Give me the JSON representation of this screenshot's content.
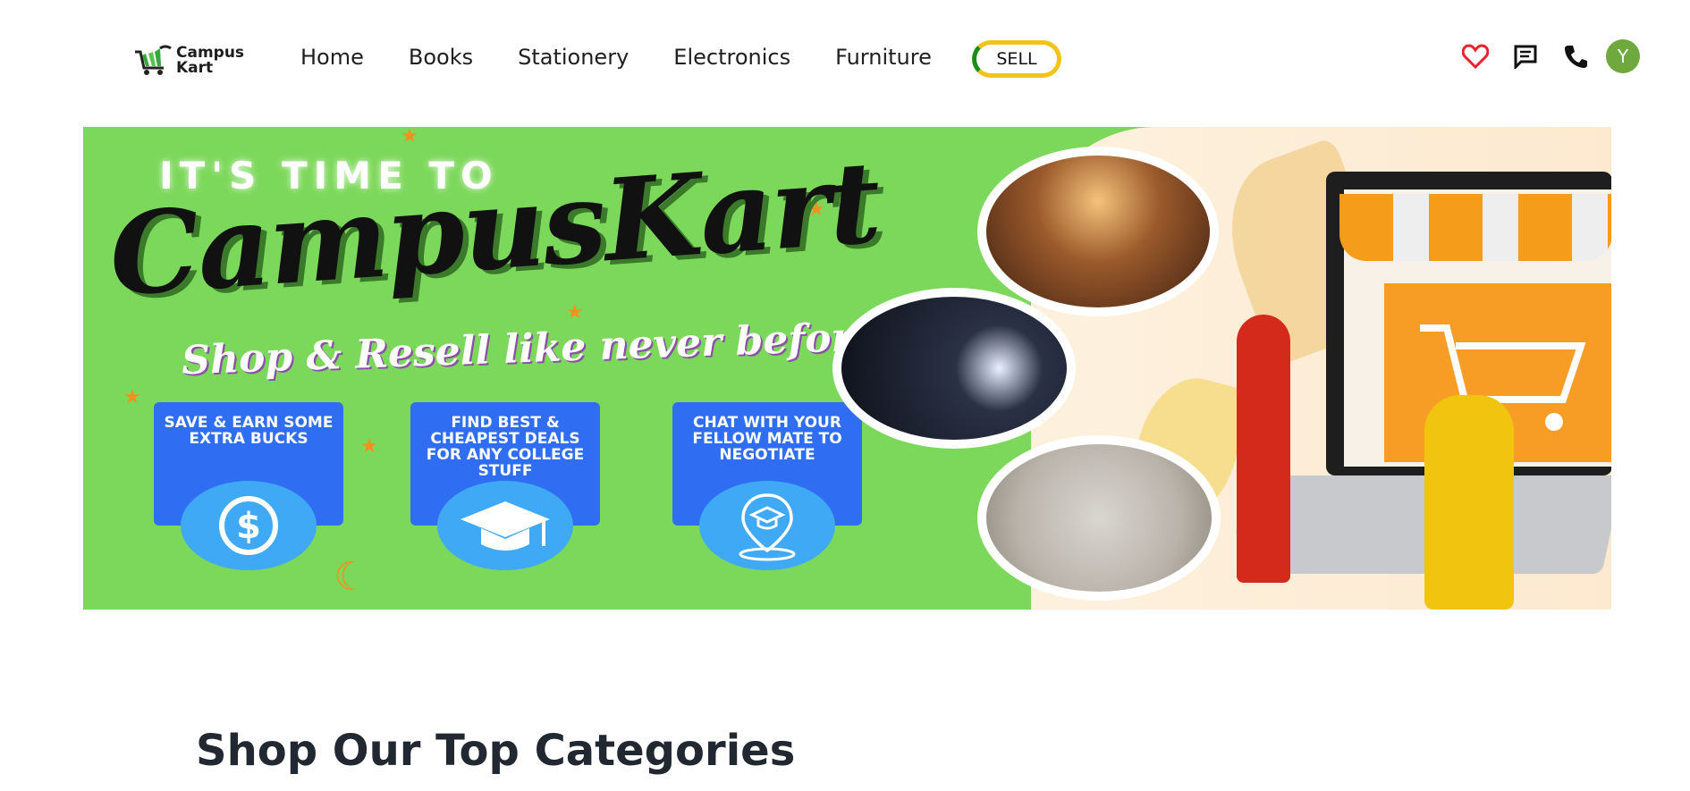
{
  "navbar": {
    "logo_line1": "Campus",
    "logo_line2": "Kart",
    "links": [
      "Home",
      "Books",
      "Stationery",
      "Electronics",
      "Furniture"
    ],
    "sell_label": "SELL",
    "icons": [
      "heart-icon",
      "chat-icon",
      "phone-icon"
    ],
    "avatar_initial": "Y"
  },
  "banner": {
    "kicker": "IT'S TIME TO",
    "title": "CampusKart",
    "tagline": "Shop & Resell like never before...",
    "features": [
      {
        "text": "SAVE & EARN SOME EXTRA BUCKS",
        "icon": "dollar-icon"
      },
      {
        "text": "FIND BEST & CHEAPEST DEALS FOR ANY COLLEGE STUFF",
        "icon": "graduation-cap-icon"
      },
      {
        "text": "CHAT WITH YOUR FELLOW MATE TO NEGOTIATE",
        "icon": "location-cap-icon"
      }
    ]
  },
  "categories": {
    "title": "Shop Our Top Categories"
  },
  "colors": {
    "banner_green": "#7cd85a",
    "card_blue": "#2f6ef2",
    "heart_red": "#e8222e",
    "avatar_green": "#6fa83c",
    "sell_yellow": "#f2c417",
    "sell_green": "#1a8c1a"
  }
}
